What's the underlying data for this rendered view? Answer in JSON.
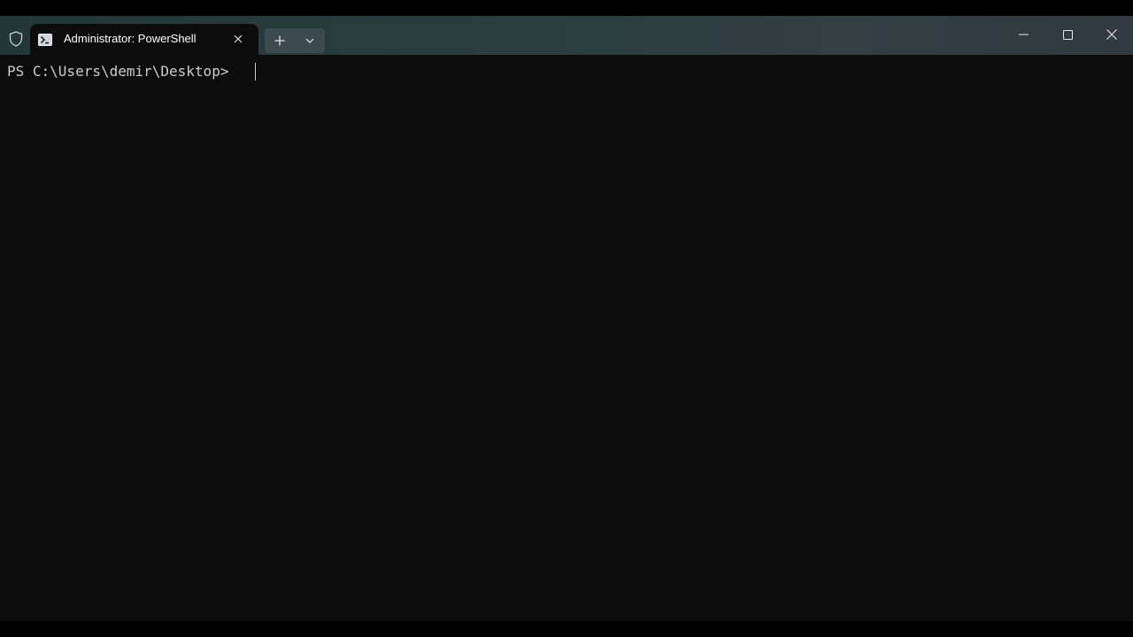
{
  "window": {
    "tab_title": "Administrator: PowerShell",
    "tab_icon": "powershell-icon",
    "admin_icon": "shield-icon",
    "new_tab_icon": "plus-icon",
    "dropdown_icon": "chevron-down-icon",
    "minimize_icon": "minimize-icon",
    "maximize_icon": "maximize-icon",
    "close_icon": "close-icon"
  },
  "terminal": {
    "prompt": "PS C:\\Users\\demir\\Desktop> "
  },
  "colors": {
    "terminal_background": "#0c0c0c",
    "terminal_text": "#cccccc",
    "titlebar": "#2b3d3f"
  }
}
